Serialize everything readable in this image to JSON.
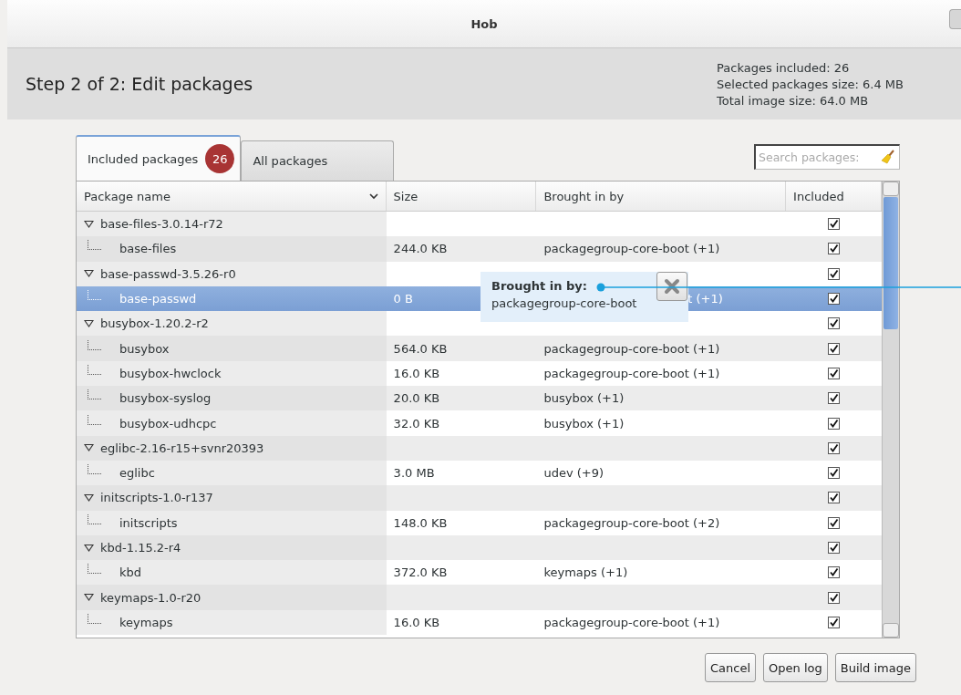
{
  "window": {
    "title": "Hob"
  },
  "header": {
    "title": "Step 2 of 2: Edit packages",
    "stats": [
      "Packages included: 26",
      "Selected packages size: 6.4 MB",
      "Total image size: 64.0 MB"
    ]
  },
  "tabs": [
    {
      "label": "Included packages",
      "badge": "26",
      "selected": true
    },
    {
      "label": "All packages",
      "selected": false
    }
  ],
  "search": {
    "placeholder": "Search packages:"
  },
  "table": {
    "columns": [
      "Package name",
      "Size",
      "Brought in by",
      "Included"
    ],
    "rows": [
      {
        "name": "base-files-3.0.14-r72",
        "included": true,
        "expanded": true,
        "selected": false,
        "children": [
          {
            "name": "base-files",
            "size": "244.0 KB",
            "brought_in_by": "packagegroup-core-boot (+1)",
            "included": true,
            "selected": false
          }
        ]
      },
      {
        "name": "base-passwd-3.5.26-r0",
        "included": true,
        "expanded": true,
        "selected": false,
        "children": [
          {
            "name": "base-passwd",
            "size": "0 B",
            "brought_in_by": "t (+1)",
            "brought_in_by_partly_hidden": true,
            "included": true,
            "selected": true
          }
        ]
      },
      {
        "name": "busybox-1.20.2-r2",
        "included": true,
        "expanded": true,
        "selected": false,
        "children": [
          {
            "name": "busybox",
            "size": "564.0 KB",
            "brought_in_by": "packagegroup-core-boot (+1)",
            "included": true,
            "selected": false
          },
          {
            "name": "busybox-hwclock",
            "size": "16.0 KB",
            "brought_in_by": "packagegroup-core-boot (+1)",
            "included": true,
            "selected": false
          },
          {
            "name": "busybox-syslog",
            "size": "20.0 KB",
            "brought_in_by": "busybox (+1)",
            "included": true,
            "selected": false
          },
          {
            "name": "busybox-udhcpc",
            "size": "32.0 KB",
            "brought_in_by": "busybox (+1)",
            "included": true,
            "selected": false
          }
        ]
      },
      {
        "name": "eglibc-2.16-r15+svnr20393",
        "included": true,
        "expanded": true,
        "selected": false,
        "children": [
          {
            "name": "eglibc",
            "size": "3.0 MB",
            "brought_in_by": "udev (+9)",
            "included": true,
            "selected": false
          }
        ]
      },
      {
        "name": "initscripts-1.0-r137",
        "included": true,
        "expanded": true,
        "selected": false,
        "children": [
          {
            "name": "initscripts",
            "size": "148.0 KB",
            "brought_in_by": "packagegroup-core-boot (+2)",
            "included": true,
            "selected": false
          }
        ]
      },
      {
        "name": "kbd-1.15.2-r4",
        "included": true,
        "expanded": true,
        "selected": false,
        "children": [
          {
            "name": "kbd",
            "size": "372.0 KB",
            "brought_in_by": "keymaps (+1)",
            "included": true,
            "selected": false
          }
        ]
      },
      {
        "name": "keymaps-1.0-r20",
        "included": true,
        "expanded": true,
        "selected": false,
        "children": [
          {
            "name": "keymaps",
            "size": "16.0 KB",
            "brought_in_by": "packagegroup-core-boot (+1)",
            "included": true,
            "selected": false
          }
        ]
      }
    ]
  },
  "tooltip": {
    "title": "Brought in by:",
    "text": "packagegroup-core-boot"
  },
  "buttons": [
    "Cancel",
    "Open log",
    "Build image"
  ]
}
